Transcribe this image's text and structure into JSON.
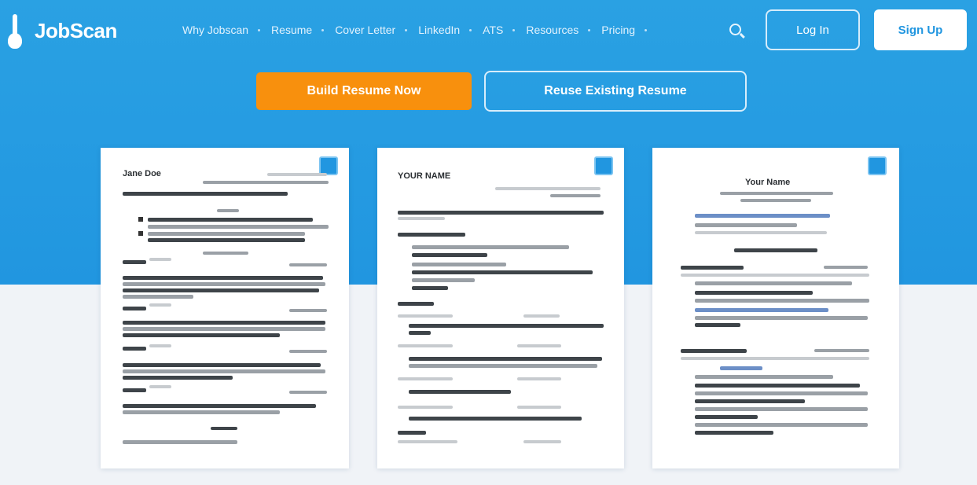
{
  "brand": {
    "name": "JobScan"
  },
  "nav": {
    "items": [
      {
        "label": "Why Jobscan"
      },
      {
        "label": "Resume"
      },
      {
        "label": "Cover Letter"
      },
      {
        "label": "LinkedIn"
      },
      {
        "label": "ATS"
      },
      {
        "label": "Resources"
      },
      {
        "label": "Pricing"
      }
    ]
  },
  "auth": {
    "login_label": "Log In",
    "signup_label": "Sign Up"
  },
  "actions": {
    "build_label": "Build Resume Now",
    "reuse_label": "Reuse Existing Resume"
  },
  "colors": {
    "hero": "#2196e0",
    "accent": "#f8900d",
    "background": "#f0f3f7"
  },
  "resumes": [
    {
      "name": "Jane Doe"
    },
    {
      "name": "YOUR NAME"
    },
    {
      "name": "Your Name"
    }
  ]
}
